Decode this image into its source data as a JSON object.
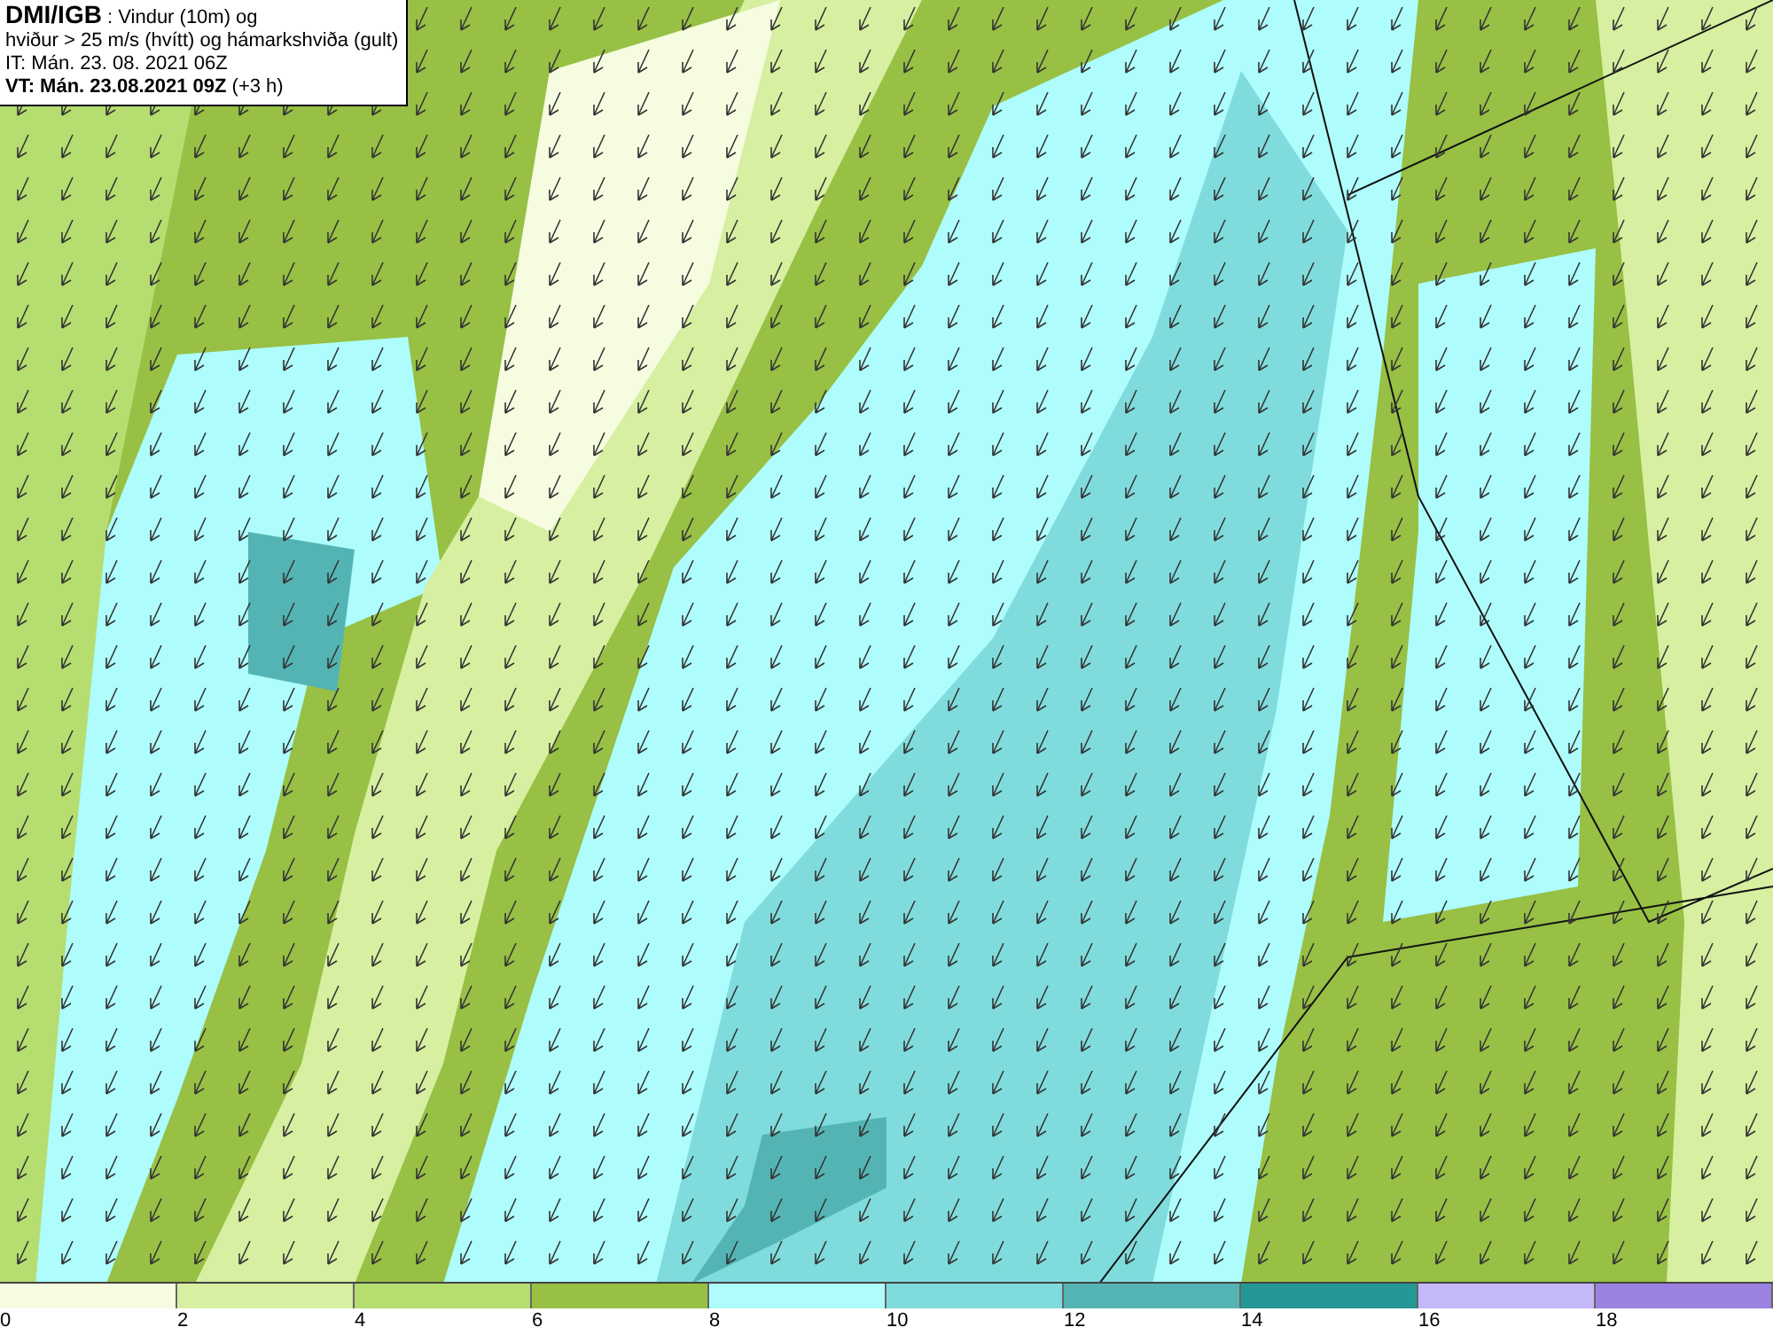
{
  "info_box": {
    "lines": [
      "**DMI/IGB** : Vindur (10m) og",
      "hviður > 25 m/s (hvítt) og hámarkshviða (gult)",
      "IT: Mán. 23. 08. 2021 06Z",
      "**VT: Mán. 23.08.2021 09Z** (+3 h)"
    ]
  },
  "legend": {
    "swatches": [
      {
        "color": "#f5fce0"
      },
      {
        "color": "#d6efa0"
      },
      {
        "color": "#b5dd70"
      },
      {
        "color": "#97c044"
      },
      {
        "color": "#aefcfc"
      },
      {
        "color": "#80dcdc"
      },
      {
        "color": "#54b4b4"
      },
      {
        "color": "#249896"
      },
      {
        "color": "#c4b8f8"
      },
      {
        "color": "#9b82e0"
      }
    ],
    "labels": [
      "0",
      "2",
      "4",
      "6",
      "8",
      "10",
      "12",
      "14",
      "16",
      "18"
    ]
  }
}
